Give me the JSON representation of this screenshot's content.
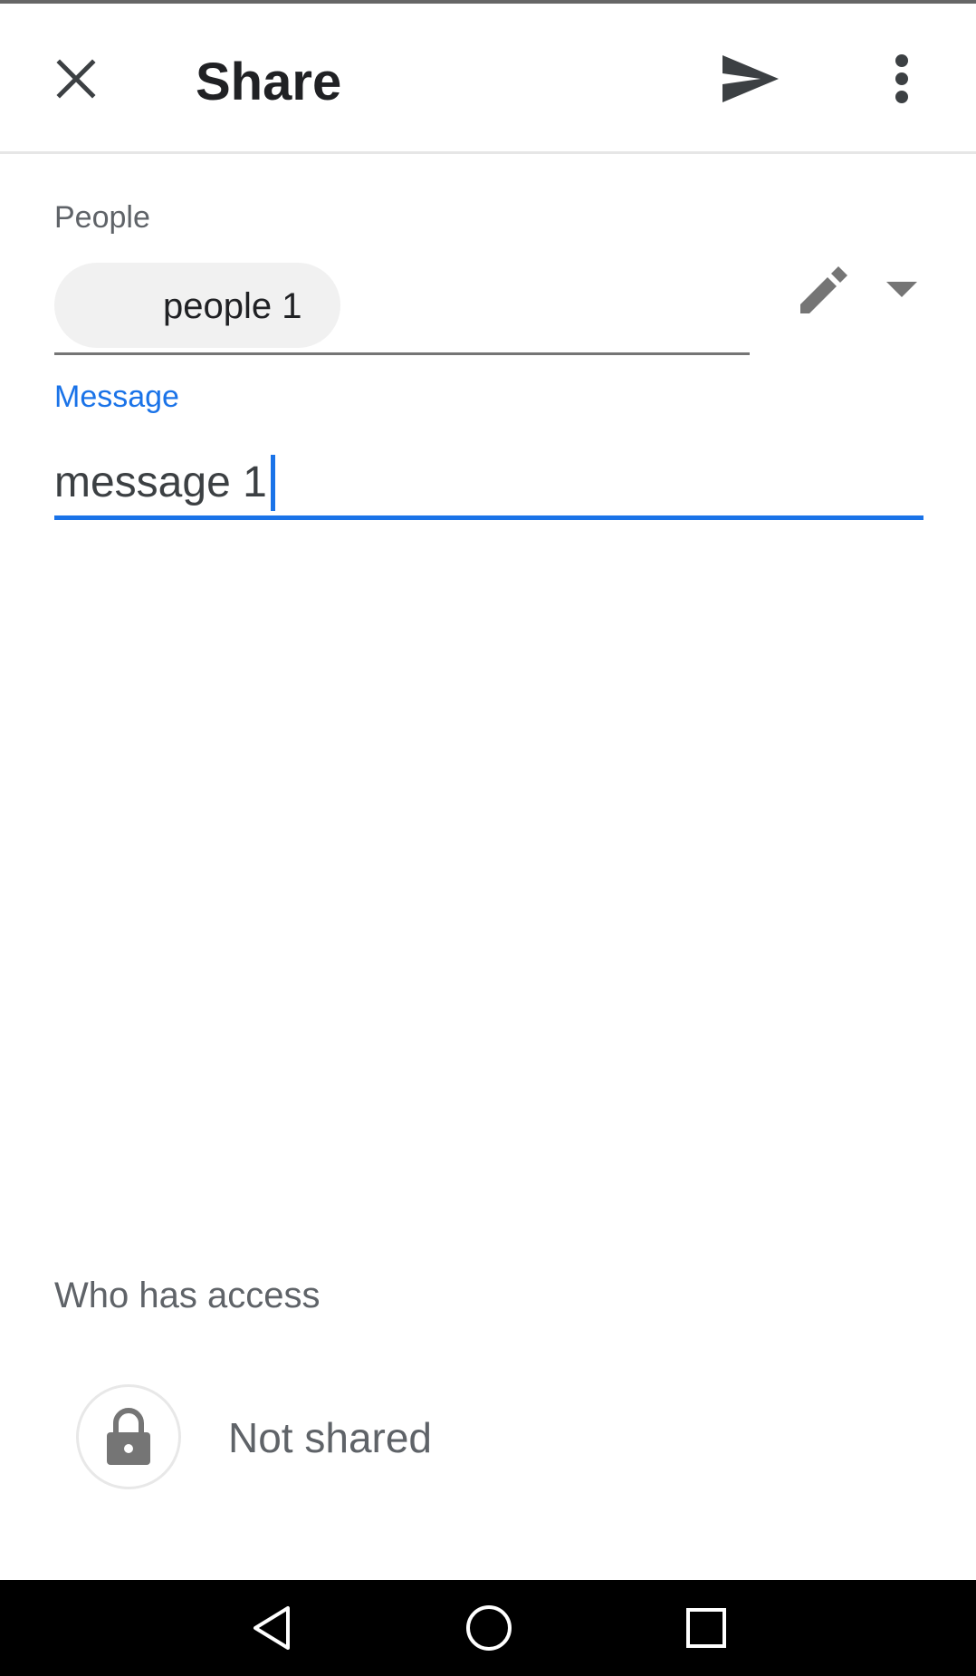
{
  "app_bar": {
    "title": "Share",
    "close_icon": "close-icon",
    "send_icon": "send-icon",
    "more_icon": "more-vert-icon"
  },
  "people": {
    "label": "People",
    "chip_text": "people 1",
    "edit_icon": "pencil-icon",
    "dropdown_icon": "arrow-drop-down-icon"
  },
  "message": {
    "label": "Message",
    "value": "message 1"
  },
  "access": {
    "heading": "Who has access",
    "icon": "lock-icon",
    "status": "Not shared"
  },
  "system_nav": {
    "back_icon": "back-triangle-icon",
    "home_icon": "home-circle-icon",
    "recents_icon": "recents-square-icon"
  },
  "colors": {
    "accent": "#1a73e8",
    "text_primary": "#202124",
    "text_secondary": "#5f6368",
    "nav_background": "#000000"
  }
}
